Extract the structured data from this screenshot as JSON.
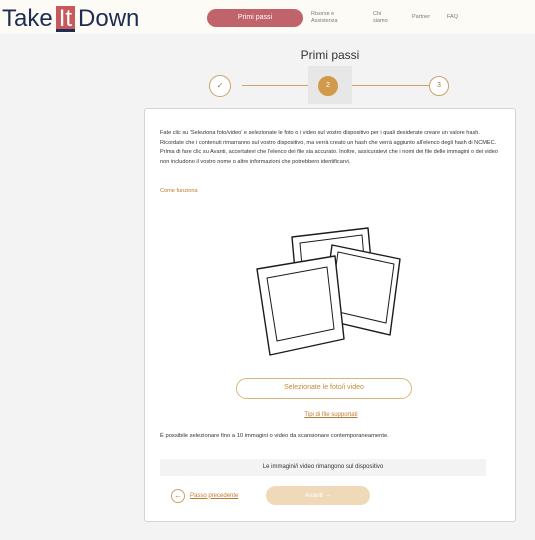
{
  "header": {
    "logo": {
      "part1": "Take",
      "highlight": "It",
      "part2": "Down"
    },
    "nav": {
      "active": "Primi passi",
      "links": [
        "Risorse e Assistenza",
        "Chi siamo",
        "Partner",
        "FAQ"
      ]
    }
  },
  "page": {
    "title": "Primi passi"
  },
  "stepper": {
    "steps": [
      "✓",
      "2",
      "3"
    ],
    "current": 2,
    "accent": "#d19a4b"
  },
  "card": {
    "intro": "Fate clic su 'Seleziona foto/video' e selezionate le foto o i video sul vostro dispositivo per i quali desiderate creare un valore hash. Ricordate che i contenuti rimarranno sul vostro dispositivo, ma verrà creato un hash che verrà aggiunto all'elenco degli hash di NCMEC. Prima di fare clic su Avanti, accertatevi che l'elenco dei file sia accurato. Inoltre, assicuratevi che i nomi dei file delle immagini o dei video non includono il vostro nome o altre informazioni che potrebbero identificarvi.",
    "how_link": "Come funziona",
    "illustration_icon": "photos-stack-illustration",
    "select_button": "Selezionate le foto/i video",
    "types_link": "Tipi di file supportati",
    "limit_text": "È possibile selezionare fino a 10 immagini o video da scansionare contemporaneamente.",
    "notice": "Le immagini/i video rimangono sul dispositivo",
    "back_label": "Passo precedente",
    "next_label": "Avanti →"
  },
  "colors": {
    "brand_navy": "#1f2d52",
    "brand_red": "#c0636a",
    "accent_gold": "#c9a36a",
    "link_orange": "#c07a2e"
  }
}
